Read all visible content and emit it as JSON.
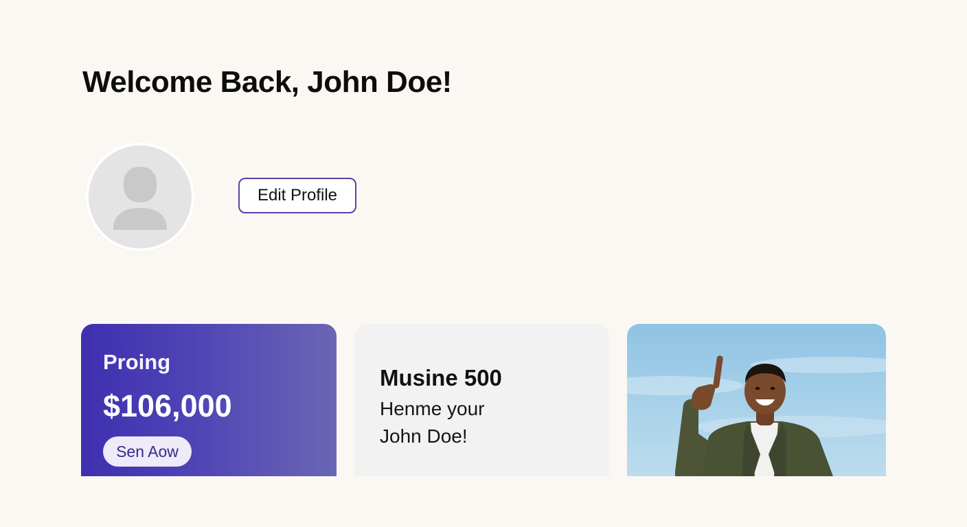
{
  "header": {
    "title": "Welcome Back, John Doe!"
  },
  "profile": {
    "avatar_icon": "user-silhouette-icon",
    "edit_button_label": "Edit Profile",
    "edit_button_border_color": "#5b3fa8"
  },
  "cards": {
    "promo": {
      "label": "Proing",
      "amount": "$106,000",
      "button_label": "Sen Aow",
      "gradient_start": "#3f2fb0",
      "gradient_end": "#6a66b4"
    },
    "info": {
      "title": "Musine 500",
      "line1": "Henme your",
      "line2": "John Doe!"
    },
    "photo": {
      "subject": "smiling-man-pointing-up-photo"
    }
  }
}
